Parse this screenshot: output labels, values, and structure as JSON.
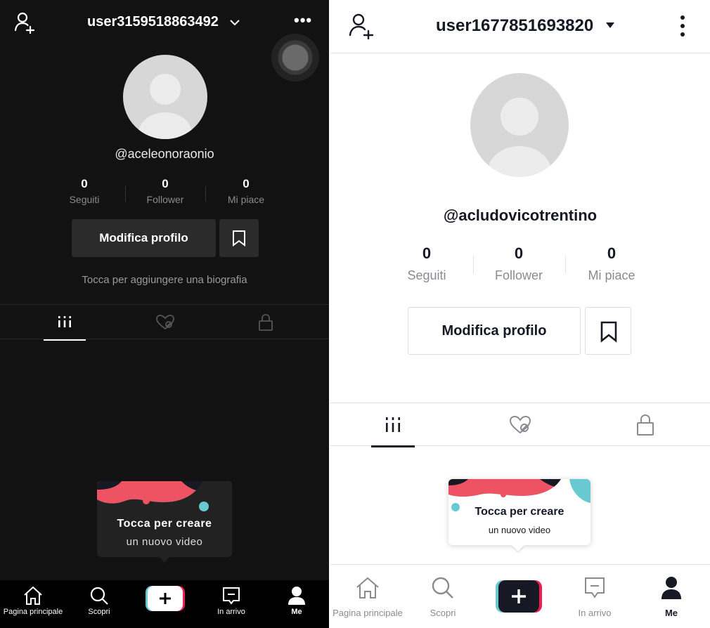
{
  "left": {
    "theme": "dark",
    "header": {
      "username": "user3159518863492",
      "more_label": "•••"
    },
    "handle": "@aceleonoraonio",
    "stats": [
      {
        "value": "0",
        "label": "Seguiti"
      },
      {
        "value": "0",
        "label": "Follower"
      },
      {
        "value": "0",
        "label": "Mi piace"
      }
    ],
    "edit_profile_label": "Modifica profilo",
    "bio_prompt": "Tocca per aggiungere una biografia",
    "promo": {
      "line1": "Tocca per creare",
      "line2": "un nuovo video"
    },
    "nav": [
      {
        "label": "Pagina principale",
        "icon": "home-icon"
      },
      {
        "label": "Scopri",
        "icon": "search-icon"
      },
      {
        "label": "",
        "icon": "create-plus-icon"
      },
      {
        "label": "In arrivo",
        "icon": "inbox-icon"
      },
      {
        "label": "Me",
        "icon": "profile-icon"
      }
    ]
  },
  "right": {
    "theme": "light",
    "header": {
      "username": "user1677851693820"
    },
    "handle": "@acludovicotrentino",
    "stats": [
      {
        "value": "0",
        "label": "Seguiti"
      },
      {
        "value": "0",
        "label": "Follower"
      },
      {
        "value": "0",
        "label": "Mi piace"
      }
    ],
    "edit_profile_label": "Modifica profilo",
    "promo": {
      "line1": "Tocca per creare",
      "line2": "un nuovo video"
    },
    "nav": [
      {
        "label": "Pagina principale",
        "icon": "home-icon"
      },
      {
        "label": "Scopri",
        "icon": "search-icon"
      },
      {
        "label": "",
        "icon": "create-plus-icon"
      },
      {
        "label": "In arrivo",
        "icon": "inbox-icon"
      },
      {
        "label": "Me",
        "icon": "profile-icon"
      }
    ]
  },
  "colors": {
    "dark_bg": "#121212",
    "light_text": "#161823",
    "muted": "#8a8b91",
    "brand_cyan": "#69c9d0",
    "brand_pink": "#ee1d52"
  }
}
